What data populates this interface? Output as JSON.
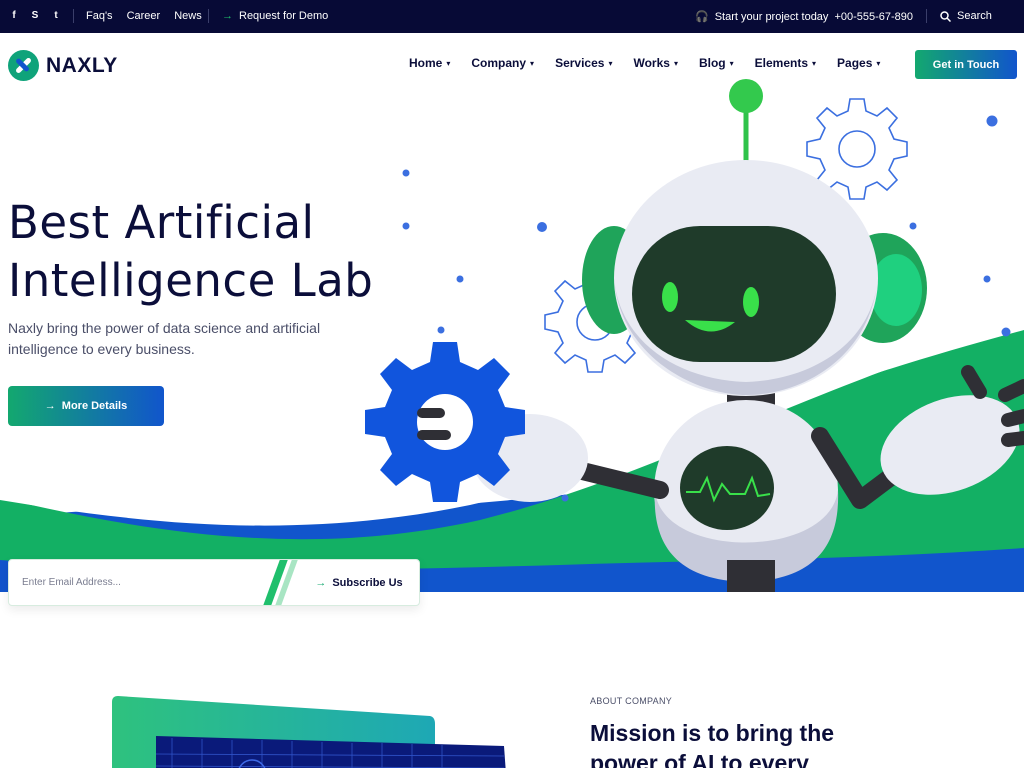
{
  "topbar": {
    "social": [
      {
        "icon": "facebook-icon",
        "glyph": "f"
      },
      {
        "icon": "skype-icon",
        "glyph": "S"
      },
      {
        "icon": "twitter-icon",
        "glyph": "t"
      }
    ],
    "links": [
      "Faq's",
      "Career",
      "News"
    ],
    "demo_label": "Request for Demo",
    "contact_label": "Start your project today",
    "phone": "+00-555-67-890",
    "search_label": "Search"
  },
  "header": {
    "logo_text": "NAXLY",
    "nav": [
      "Home",
      "Company",
      "Services",
      "Works",
      "Blog",
      "Elements",
      "Pages"
    ],
    "cta_label": "Get in Touch"
  },
  "hero": {
    "title_line1": "Best Artificial",
    "title_line2": "Intelligence Lab",
    "subtitle": "Naxly bring the power of data science and artificial intelligence to every business.",
    "button_label": "More Details"
  },
  "subscribe": {
    "placeholder": "Enter Email Address...",
    "button_label": "Subscribe Us"
  },
  "about": {
    "label": "ABOUT COMPANY",
    "title": "Mission is to bring the power of AI to every"
  },
  "colors": {
    "navy": "#070a36",
    "green": "#13a86f",
    "blue": "#1155cc",
    "robot_face": "#1f3b2a",
    "robot_glow": "#39e04a"
  }
}
